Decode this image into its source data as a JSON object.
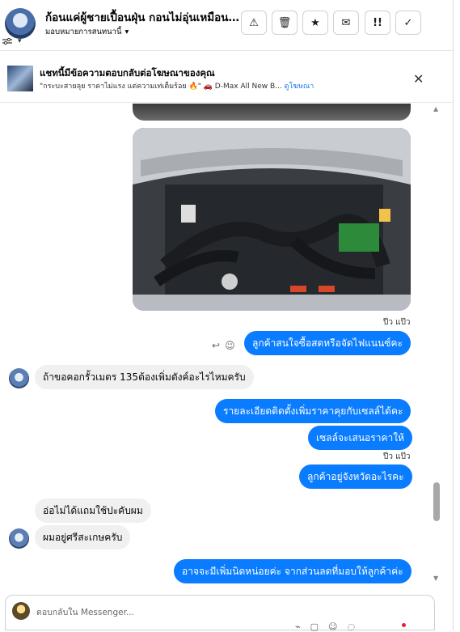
{
  "header": {
    "title": "ก้อนแค่ผู้ชายเปื้อนฝุ่น กอนไม่อุ่นเหมือนคน...",
    "subtitle": "มอบหมายการสนทนานี้",
    "chevron": "▾",
    "toolbar": [
      {
        "icon": "warning-icon",
        "glyph": "⚠"
      },
      {
        "icon": "trash-icon",
        "glyph": "🗑"
      },
      {
        "icon": "star-icon",
        "glyph": "★"
      },
      {
        "icon": "mail-icon",
        "glyph": "✉"
      },
      {
        "icon": "spam-icon",
        "glyph": "!!"
      },
      {
        "icon": "check-icon",
        "glyph": "✓"
      }
    ]
  },
  "ad": {
    "title": "แชทนี้มีข้อความตอบกลับต่อโฆษณาของคุณ",
    "snippet": "\"กระบะสายลุย ราคาไม่แรง แต่ความเท่เต็มร้อย 🔥\" 🚗 D-Max All New B...",
    "link": "ดูโฆษณา",
    "close": "✕"
  },
  "messages": {
    "ts1": "ปีว แป๊ว",
    "m1": "ลูกค้าสนใจซื้อสดหรือจัดไฟแนนซ์คะ",
    "m2": "ถ้าขอคอกรั้วเมตร 135ต้องเพิ่มตังค์อะไรไหมครับ",
    "m3": "รายละเอียดติดตั้งเพิ่มราคาคุยกับเซลล์ได้คะ",
    "m4": "เซลล์จะเสนอราคาให้",
    "ts2": "ปีว แป๊ว",
    "m5": "ลูกค้าอยู่จังหวัดอะไรคะ",
    "m6": "อ่อไม่ได้แถมใช้ปะคับผม",
    "m7": "ผมอยู่ศรีสะเกษครับ",
    "m8": "อาจจะมีเพิ่มนิดหน่อยค่ะ จากส่วนลดที่มอบให้ลูกค้าค่ะ"
  },
  "composer": {
    "placeholder": "ตอบกลับใน Messenger..."
  }
}
